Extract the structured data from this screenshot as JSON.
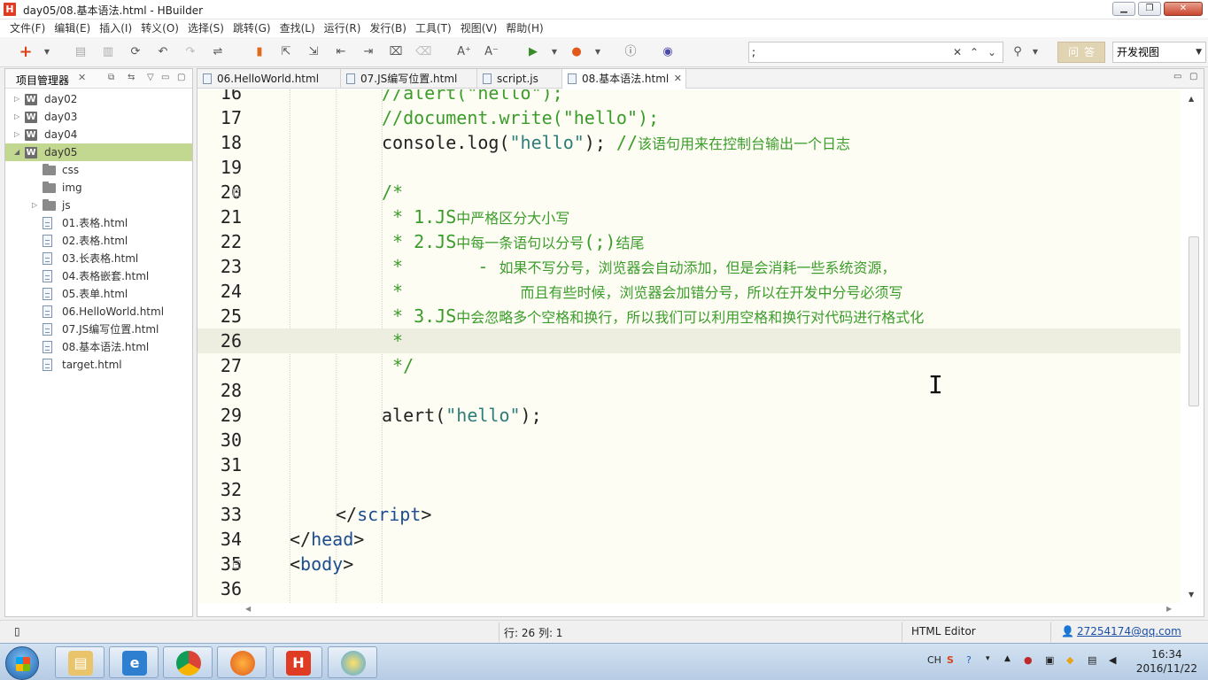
{
  "window": {
    "title": "day05/08.基本语法.html  -  HBuilder",
    "app_logo": "H"
  },
  "menu": [
    "文件(F)",
    "编辑(E)",
    "插入(I)",
    "转义(O)",
    "选择(S)",
    "跳转(G)",
    "查找(L)",
    "运行(R)",
    "发行(B)",
    "工具(T)",
    "视图(V)",
    "帮助(H)"
  ],
  "toolbar": {
    "search_value": ";",
    "ask_label": "问答",
    "view_select": "开发视图"
  },
  "project_panel": {
    "title": "项目管理器",
    "tree": [
      {
        "label": "day02",
        "type": "project"
      },
      {
        "label": "day03",
        "type": "project"
      },
      {
        "label": "day04",
        "type": "project"
      },
      {
        "label": "day05",
        "type": "project"
      },
      {
        "label": "css",
        "type": "folder"
      },
      {
        "label": "img",
        "type": "folder"
      },
      {
        "label": "js",
        "type": "folder"
      },
      {
        "label": "01.表格.html",
        "type": "file"
      },
      {
        "label": "02.表格.html",
        "type": "file"
      },
      {
        "label": "03.长表格.html",
        "type": "file"
      },
      {
        "label": "04.表格嵌套.html",
        "type": "file"
      },
      {
        "label": "05.表单.html",
        "type": "file"
      },
      {
        "label": "06.HelloWorld.html",
        "type": "file"
      },
      {
        "label": "07.JS编写位置.html",
        "type": "file"
      },
      {
        "label": "08.基本语法.html",
        "type": "file"
      },
      {
        "label": "target.html",
        "type": "file"
      }
    ]
  },
  "tabs": [
    {
      "label": "06.HelloWorld.html"
    },
    {
      "label": "07.JS编写位置.html"
    },
    {
      "label": "script.js"
    },
    {
      "label": "08.基本语法.html",
      "active": true
    }
  ],
  "code_lines": [
    {
      "n": "16",
      "parts": [
        [
          "c-comment",
          "//alert(\"hello\");"
        ]
      ]
    },
    {
      "n": "17",
      "parts": [
        [
          "c-comment",
          "//document.write(\"hello\");"
        ]
      ]
    },
    {
      "n": "18",
      "parts": [
        [
          "c-plain",
          "console.log("
        ],
        [
          "c-str",
          "\"hello\""
        ],
        [
          "c-plain",
          "); "
        ],
        [
          "c-comment",
          "//"
        ],
        [
          "c-comment c-zh",
          "该语句用来在控制台输出一个日志"
        ]
      ]
    },
    {
      "n": "19",
      "parts": []
    },
    {
      "n": "20",
      "parts": [
        [
          "c-comment",
          "/*"
        ]
      ],
      "fold": true
    },
    {
      "n": "21",
      "parts": [
        [
          "c-comment",
          " * 1.JS"
        ],
        [
          "c-comment c-zh",
          "中严格区分大小写"
        ]
      ]
    },
    {
      "n": "22",
      "parts": [
        [
          "c-comment",
          " * 2.JS"
        ],
        [
          "c-comment c-zh",
          "中每一条语句以分号"
        ],
        [
          "c-comment",
          "(;)"
        ],
        [
          "c-comment c-zh",
          "结尾"
        ]
      ]
    },
    {
      "n": "23",
      "parts": [
        [
          "c-comment",
          " *       - "
        ],
        [
          "c-comment c-zh",
          "如果不写分号，浏览器会自动添加，但是会消耗一些系统资源，"
        ]
      ]
    },
    {
      "n": "24",
      "parts": [
        [
          "c-comment",
          " *           "
        ],
        [
          "c-comment c-zh",
          "而且有些时候，浏览器会加错分号，所以在开发中分号必须写"
        ]
      ]
    },
    {
      "n": "25",
      "parts": [
        [
          "c-comment",
          " * 3.JS"
        ],
        [
          "c-comment c-zh",
          "中会忽略多个空格和换行，所以我们可以利用空格和换行对代码进行格式化"
        ]
      ]
    },
    {
      "n": "26",
      "parts": [
        [
          "c-comment",
          " *"
        ]
      ],
      "current": true
    },
    {
      "n": "27",
      "parts": [
        [
          "c-comment",
          " */"
        ]
      ]
    },
    {
      "n": "28",
      "parts": []
    },
    {
      "n": "29",
      "parts": [
        [
          "c-plain",
          "alert("
        ],
        [
          "c-str",
          "\"hello\""
        ],
        [
          "c-plain",
          ");"
        ]
      ]
    },
    {
      "n": "30",
      "parts": []
    },
    {
      "n": "31",
      "parts": []
    },
    {
      "n": "32",
      "parts": []
    },
    {
      "n": "33",
      "parts": [
        [
          "c-plain",
          "</"
        ],
        [
          "c-tag",
          "script"
        ],
        [
          "c-plain",
          ">"
        ]
      ]
    },
    {
      "n": "34",
      "parts": [
        [
          "c-plain",
          "</"
        ],
        [
          "c-tag",
          "head"
        ],
        [
          "c-plain",
          ">"
        ]
      ]
    },
    {
      "n": "35",
      "parts": [
        [
          "c-plain",
          "<"
        ],
        [
          "c-tag",
          "body"
        ],
        [
          "c-plain",
          ">"
        ]
      ],
      "fold": true
    },
    {
      "n": "36",
      "parts": []
    }
  ],
  "status": {
    "position": "行: 26 列: 1",
    "editor_type": "HTML Editor",
    "account": "27254174@qq.com"
  },
  "taskbar": {
    "lang": "CH",
    "time": "16:34",
    "date": "2016/11/22"
  },
  "colors": {
    "selected_row": "#c2d890",
    "editor_bg": "#fefdf3",
    "comment": "#3b9c2c",
    "string": "#2e7d7a",
    "tag": "#1c4d8f"
  }
}
